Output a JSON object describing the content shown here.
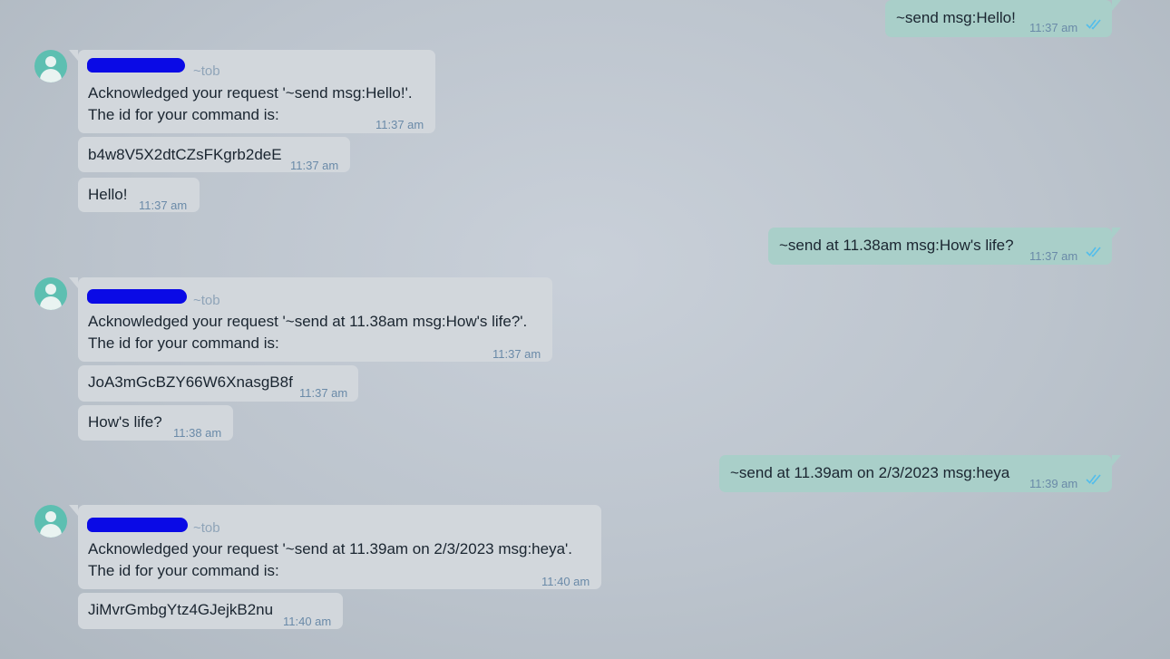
{
  "conversation": {
    "msg1": {
      "text": "~send msg:Hello!",
      "time": "11:37 am"
    },
    "bot1": {
      "sender_tag": "~tob",
      "line1": "Acknowledged your request '~send msg:Hello!'.",
      "line2": "The id for your command is:",
      "time": "11:37 am",
      "id_text": "b4w8V5X2dtCZsFKgrb2deE",
      "id_time": "11:37 am",
      "echo_text": "Hello!",
      "echo_time": "11:37 am"
    },
    "msg2": {
      "text": "~send at 11.38am msg:How's life?",
      "time": "11:37 am"
    },
    "bot2": {
      "sender_tag": "~tob",
      "line1": "Acknowledged your request '~send at 11.38am msg:How's life?'.",
      "line2": "The id for your command is:",
      "time": "11:37 am",
      "id_text": "JoA3mGcBZY66W6XnasgB8f",
      "id_time": "11:37 am",
      "echo_text": "How's life?",
      "echo_time": "11:38 am"
    },
    "msg3": {
      "text": "~send at 11.39am on 2/3/2023 msg:heya",
      "time": "11:39 am"
    },
    "bot3": {
      "sender_tag": "~tob",
      "line1": "Acknowledged your request '~send at 11.39am on 2/3/2023 msg:heya'.",
      "line2": "The id for your command is:",
      "time": "11:40 am",
      "id_text": "JiMvrGmbgYtz4GJejkB2nu",
      "id_time": "11:40 am"
    }
  },
  "icons": {
    "avatar": "default-user-avatar-icon",
    "read_receipt": "double-check-icon"
  },
  "colors": {
    "incoming_bubble": "#d2d7dc",
    "outgoing_bubble": "#a9cfc9",
    "avatar": "#5dbfb1",
    "timestamp": "#6a8aa8",
    "ticks": "#53bdeb",
    "redaction": "#0a0ae6"
  }
}
